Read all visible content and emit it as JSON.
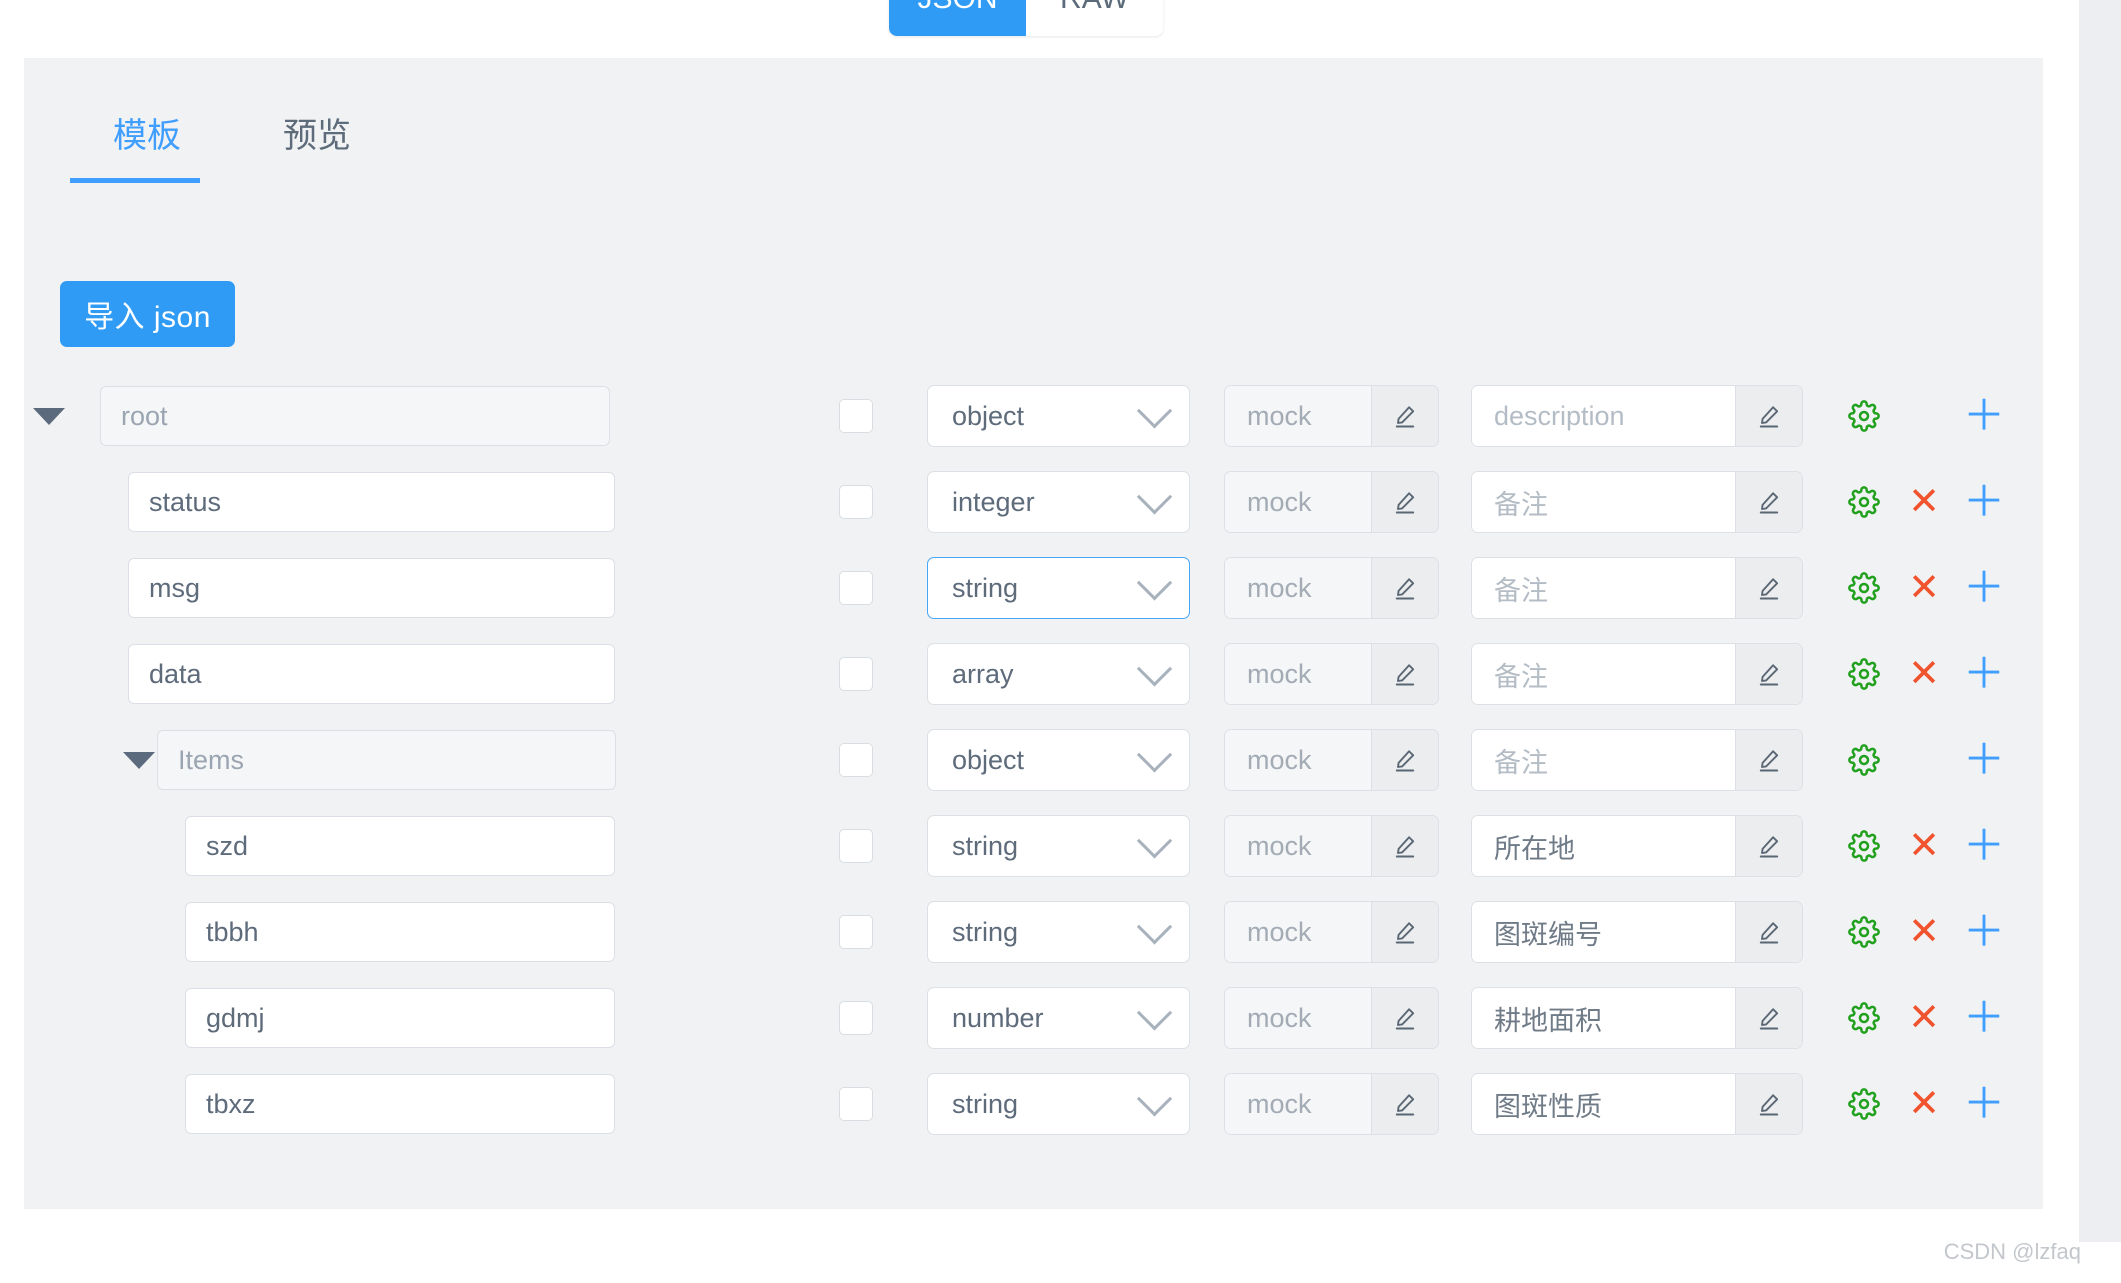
{
  "top_toggle": {
    "options": [
      "JSON",
      "RAW"
    ],
    "active": "JSON"
  },
  "tabs": [
    {
      "label": "模板",
      "active": true
    },
    {
      "label": "预览",
      "active": false
    }
  ],
  "import_button": {
    "label": "导入 json"
  },
  "column_defaults": {
    "mock_placeholder": "mock",
    "pen_icon": "pencil-icon",
    "gear_icon": "gear-icon",
    "remove_icon": "close-icon",
    "add_icon": "plus-icon"
  },
  "colors": {
    "accent_blue": "#409eff",
    "button_blue": "#2f9bf5",
    "gear_green": "#22a11e",
    "remove_red": "#f0532e",
    "panel_bg": "#f1f2f4"
  },
  "schema_rows": [
    {
      "indent": 0,
      "caret": true,
      "name": "root",
      "name_is_placeholder": true,
      "checked": false,
      "type": "object",
      "type_focused": false,
      "mock": "mock",
      "description": "description",
      "description_is_placeholder": true,
      "has_remove": false
    },
    {
      "indent": 1,
      "caret": false,
      "name": "status",
      "name_is_placeholder": false,
      "checked": false,
      "type": "integer",
      "type_focused": false,
      "mock": "mock",
      "description": "备注",
      "description_is_placeholder": true,
      "has_remove": true
    },
    {
      "indent": 1,
      "caret": false,
      "name": "msg",
      "name_is_placeholder": false,
      "checked": false,
      "type": "string",
      "type_focused": true,
      "mock": "mock",
      "description": "备注",
      "description_is_placeholder": true,
      "has_remove": true
    },
    {
      "indent": 1,
      "caret": false,
      "name": "data",
      "name_is_placeholder": false,
      "checked": false,
      "type": "array",
      "type_focused": false,
      "mock": "mock",
      "description": "备注",
      "description_is_placeholder": true,
      "has_remove": true
    },
    {
      "indent": 2,
      "caret": true,
      "name": "Items",
      "name_is_placeholder": true,
      "checked": false,
      "type": "object",
      "type_focused": false,
      "mock": "mock",
      "description": "备注",
      "description_is_placeholder": true,
      "has_remove": false
    },
    {
      "indent": 3,
      "caret": false,
      "name": "szd",
      "name_is_placeholder": false,
      "checked": false,
      "type": "string",
      "type_focused": false,
      "mock": "mock",
      "description": "所在地",
      "description_is_placeholder": false,
      "has_remove": true
    },
    {
      "indent": 3,
      "caret": false,
      "name": "tbbh",
      "name_is_placeholder": false,
      "checked": false,
      "type": "string",
      "type_focused": false,
      "mock": "mock",
      "description": "图斑编号",
      "description_is_placeholder": false,
      "has_remove": true
    },
    {
      "indent": 3,
      "caret": false,
      "name": "gdmj",
      "name_is_placeholder": false,
      "checked": false,
      "type": "number",
      "type_focused": false,
      "mock": "mock",
      "description": "耕地面积",
      "description_is_placeholder": false,
      "has_remove": true
    },
    {
      "indent": 3,
      "caret": false,
      "name": "tbxz",
      "name_is_placeholder": false,
      "checked": false,
      "type": "string",
      "type_focused": false,
      "mock": "mock",
      "description": "图斑性质",
      "description_is_placeholder": false,
      "has_remove": true
    }
  ],
  "watermark": {
    "text": "CSDN @lzfaq"
  }
}
